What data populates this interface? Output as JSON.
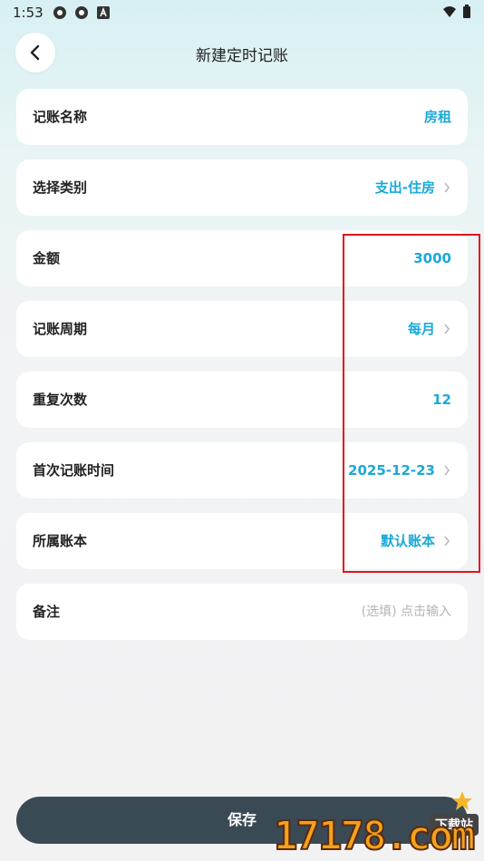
{
  "status": {
    "time": "1:53"
  },
  "header": {
    "title": "新建定时记账"
  },
  "rows": [
    {
      "label": "记账名称",
      "value": "房租"
    },
    {
      "label": "选择类别",
      "value": "支出-住房"
    },
    {
      "label": "金额",
      "value": "3000"
    },
    {
      "label": "记账周期",
      "value": "每月"
    },
    {
      "label": "重复次数",
      "value": "12"
    },
    {
      "label": "首次记账时间",
      "value": "2025-12-23"
    },
    {
      "label": "所属账本",
      "value": "默认账本"
    },
    {
      "label": "备注",
      "placeholder": "(选填) 点击输入"
    }
  ],
  "save_label": "保存",
  "watermark": {
    "number": "17178.com",
    "badge": "下载站"
  },
  "colors": {
    "accent": "#1aa9d8",
    "save_button": "#3a4a55",
    "highlight_box": "#e0141f"
  }
}
